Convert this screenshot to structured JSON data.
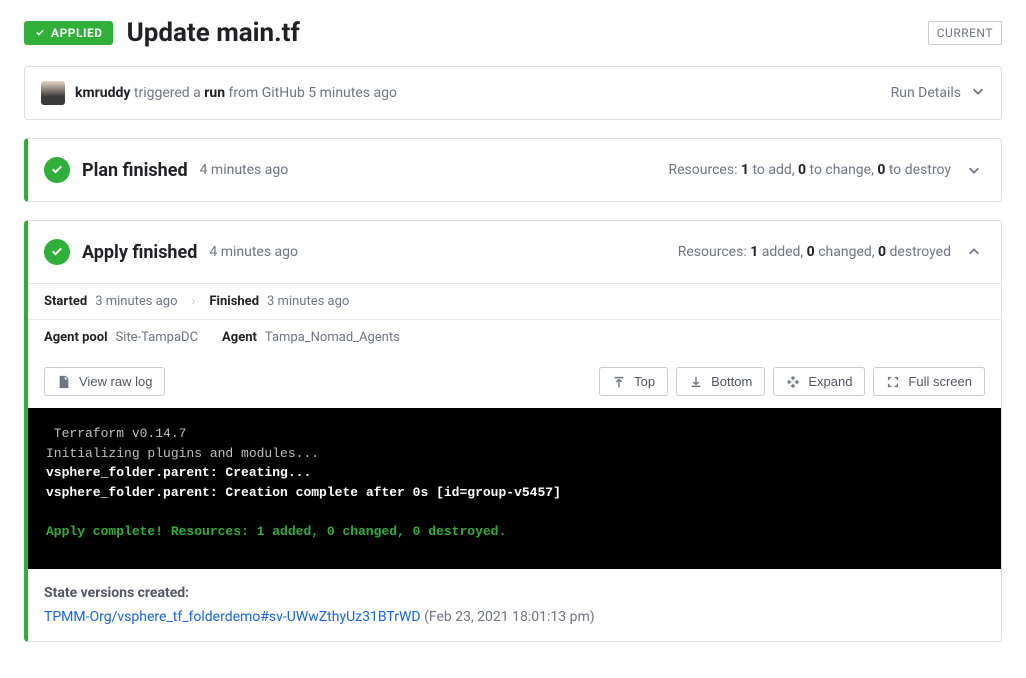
{
  "header": {
    "applied_badge": "APPLIED",
    "title": "Update main.tf",
    "current_badge": "CURRENT"
  },
  "trigger": {
    "user": "kmruddy",
    "verb": " triggered a ",
    "object": "run",
    "suffix": " from GitHub 5 minutes ago",
    "run_details_label": "Run Details"
  },
  "plan": {
    "title": "Plan finished",
    "time": "4 minutes ago",
    "resources_prefix": "Resources: ",
    "add": "1",
    "add_suffix": " to add, ",
    "change": "0",
    "change_suffix": " to change, ",
    "destroy": "0",
    "destroy_suffix": " to destroy"
  },
  "apply": {
    "title": "Apply finished",
    "time": "4 minutes ago",
    "resources_prefix": "Resources: ",
    "added": "1",
    "added_suffix": " added, ",
    "changed": "0",
    "changed_suffix": " changed, ",
    "destroyed": "0",
    "destroyed_suffix": " destroyed",
    "started_label": "Started",
    "started_time": "3 minutes ago",
    "finished_label": "Finished",
    "finished_time": "3 minutes ago",
    "agent_pool_label": "Agent pool",
    "agent_pool_value": "Site-TampaDC",
    "agent_label": "Agent",
    "agent_value": "Tampa_Nomad_Agents"
  },
  "log_toolbar": {
    "view_raw": "View raw log",
    "top": "Top",
    "bottom": "Bottom",
    "expand": "Expand",
    "fullscreen": "Full screen"
  },
  "terminal": {
    "line1": " Terraform v0.14.7",
    "line2": "Initializing plugins and modules...",
    "line3": "vsphere_folder.parent: Creating...",
    "line4": "vsphere_folder.parent: Creation complete after 0s [id=group-v5457]",
    "line5": "Apply complete! Resources: 1 added, 0 changed, 0 destroyed."
  },
  "state": {
    "heading": "State versions created:",
    "link_text": "TPMM-Org/vsphere_tf_folderdemo#sv-UWwZthyUz31BTrWD",
    "timestamp": " (Feb 23, 2021 18:01:13 pm)"
  }
}
